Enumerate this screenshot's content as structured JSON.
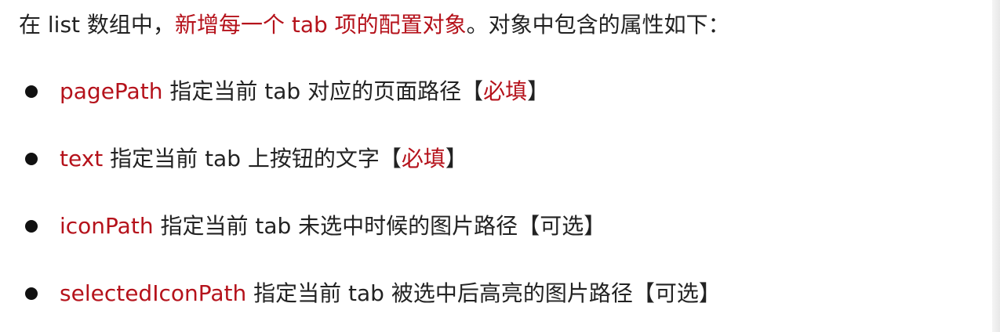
{
  "intro": {
    "prefix": "在 list 数组中，",
    "highlight": "新增每一个 tab 项的配置对象",
    "suffix": "。对象中包含的属性如下："
  },
  "items": [
    {
      "name": "pagePath",
      "desc": " 指定当前 tab 对应的页面路径",
      "open": "【",
      "tag": "必填",
      "close": "】",
      "tag_required": true
    },
    {
      "name": "text",
      "desc": " 指定当前 tab 上按钮的文字",
      "open": "【",
      "tag": "必填",
      "close": "】",
      "tag_required": true
    },
    {
      "name": "iconPath",
      "desc": " 指定当前 tab 未选中时候的图片路径",
      "open": "【",
      "tag": "可选",
      "close": "】",
      "tag_required": false
    },
    {
      "name": "selectedIconPath",
      "desc": " 指定当前 tab 被选中后高亮的图片路径",
      "open": "【",
      "tag": "可选",
      "close": "】",
      "tag_required": false
    }
  ],
  "colors": {
    "accent": "#b5121b",
    "text": "#222222",
    "bullet": "#111111"
  }
}
